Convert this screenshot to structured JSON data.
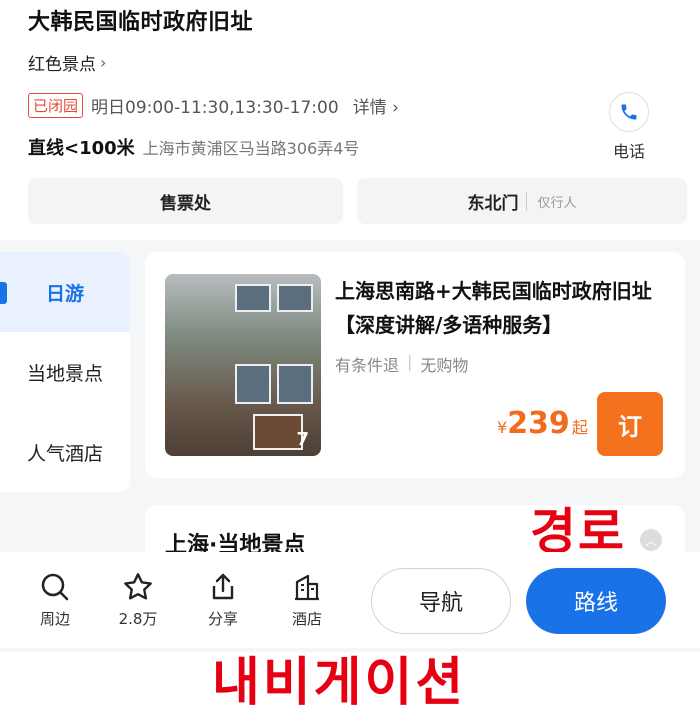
{
  "poi": {
    "title": "大韩民国临时政府旧址",
    "category": "红色景点",
    "status_badge": "已闭园",
    "hours": "明日09:00-11:30,13:30-17:00",
    "detail_label": "详情",
    "distance": "直线<100米",
    "address": "上海市黄浦区马当路306弄4号",
    "phone_label": "电话"
  },
  "entrances": [
    {
      "label": "售票处"
    },
    {
      "label": "东北门",
      "note": "仅行人"
    }
  ],
  "sidenav": {
    "items": [
      {
        "label": "日游"
      },
      {
        "label": "当地景点"
      },
      {
        "label": "人气酒店"
      }
    ]
  },
  "card": {
    "title": "上海思南路+大韩民国临时政府旧址【深度讲解/多语种服务】",
    "tags": [
      "有条件退",
      "无购物"
    ],
    "photo_count": "7",
    "currency": "¥",
    "price": "239",
    "price_suffix": "起",
    "book_label": "订"
  },
  "section2": {
    "title": "上海·当地景点"
  },
  "bottom_bar": {
    "items": [
      {
        "label": "周边",
        "icon": "search-icon"
      },
      {
        "label": "2.8万",
        "icon": "star-icon"
      },
      {
        "label": "分享",
        "icon": "share-icon"
      },
      {
        "label": "酒店",
        "icon": "hotel-icon"
      }
    ],
    "nav_label": "导航",
    "route_label": "路线"
  },
  "overlay": {
    "route_ko": "경로",
    "nav_ko": "내비게이션"
  },
  "colors": {
    "accent": "#1a72e8",
    "price": "#f26b1d",
    "closed": "#e54b3c",
    "overlay_red": "#e60012"
  }
}
